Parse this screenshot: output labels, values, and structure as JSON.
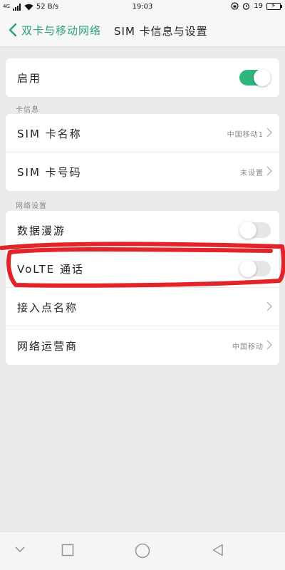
{
  "status_bar": {
    "signal": "4G",
    "speed": "52 B/s",
    "time": "19:03",
    "battery": "19"
  },
  "header": {
    "back_label": "双卡与移动网络",
    "title": "SIM 卡信息与设置"
  },
  "enable_row": {
    "label": "启用",
    "enabled": true
  },
  "card_info": {
    "section_label": "卡信息",
    "sim_name_label": "SIM 卡名称",
    "sim_name_value": "中国移动1",
    "sim_number_label": "SIM 卡号码",
    "sim_number_value": "未设置"
  },
  "network": {
    "section_label": "网络设置",
    "roaming_label": "数据漫游",
    "roaming_enabled": false,
    "volte_label": "VoLTE 通话",
    "volte_enabled": false,
    "apn_label": "接入点名称",
    "carrier_label": "网络运营商",
    "carrier_value": "中国移动"
  },
  "colors": {
    "accent": "#2aa376",
    "toggle_on": "#2fb57e",
    "annotation": "#e3232a"
  },
  "icons": {
    "back": "chevron-left-icon",
    "row_arrow": "chevron-right-icon",
    "nav_down": "chevron-down-icon",
    "nav_recents": "square-icon",
    "nav_home": "circle-icon",
    "nav_back": "triangle-back-icon"
  }
}
